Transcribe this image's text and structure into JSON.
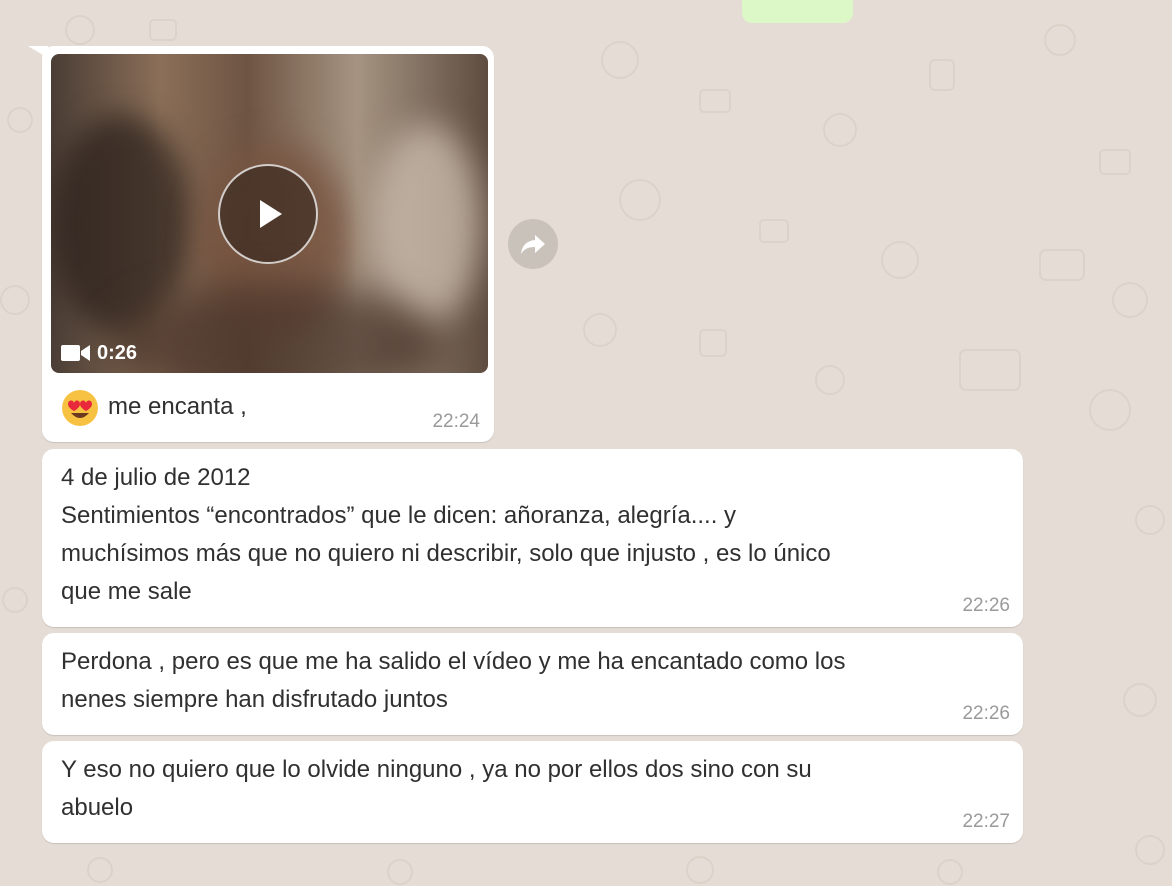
{
  "video_message": {
    "duration": "0:26",
    "caption": "me encanta ,",
    "time": "22:24",
    "emoji": "heart-eyes"
  },
  "messages": [
    {
      "text": "4 de julio de 2012\nSentimientos “encontrados” que le dicen: añoranza, alegría.... y\nmuchísimos más que no quiero ni describir, solo que injusto , es lo único\nque me sale",
      "time": "22:26"
    },
    {
      "text": "Perdona , pero es que me ha salido el vídeo y me ha encantado como los\nnenes siempre han disfrutado juntos",
      "time": "22:26"
    },
    {
      "text": "Y eso no quiero que lo olvide ninguno , ya no por ellos dos sino con su\nabuelo",
      "time": "22:27"
    }
  ],
  "colors": {
    "chat_background": "#e5ddd5",
    "incoming_bubble": "#ffffff",
    "outgoing_bubble": "#dcf8c6"
  }
}
